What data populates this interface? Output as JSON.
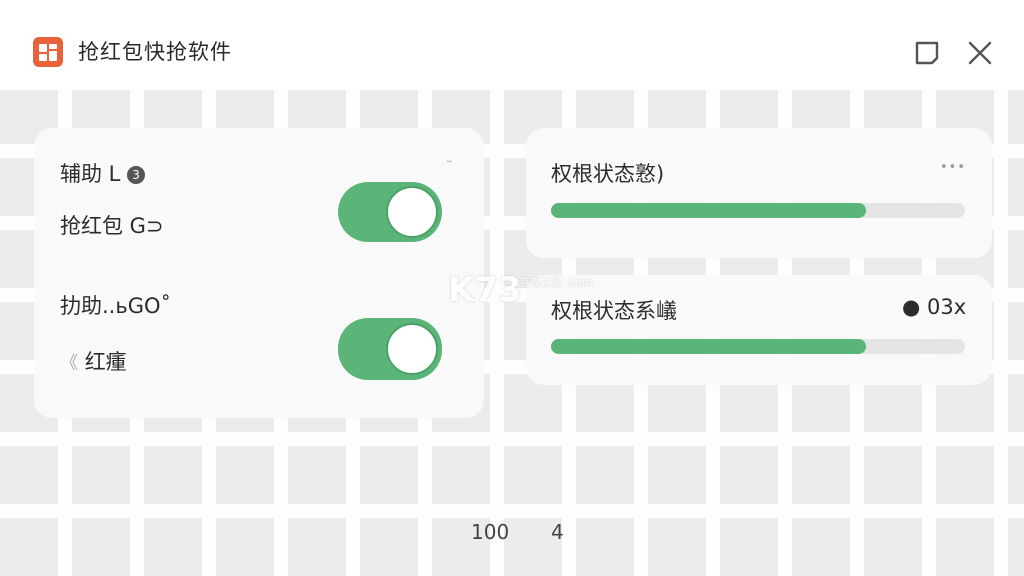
{
  "window": {
    "title": "抢红包快抢软件"
  },
  "left_panel": {
    "row1_label": "辅助 ᒪ",
    "row1_suffix": "3",
    "row2_label": "抢红包 G⊃",
    "row3_label": "扐助..ьGO˚",
    "row4_label": "红瘇",
    "row4_prefix": "《",
    "toggle1_on": true,
    "toggle2_on": true,
    "dots": "¨"
  },
  "right_panel": {
    "status1_label": "权根状态憝)",
    "status1_dots": "•••",
    "status1_progress": 0.76,
    "status2_label": "权根状态系嶬",
    "status2_value": "● 03x",
    "status2_progress": 0.76
  },
  "watermark": {
    "main": "K73",
    "sub": "游戏之家 .com"
  },
  "footer": {
    "left_num": "100",
    "right_num": "4"
  },
  "colors": {
    "accent": "#5bb478",
    "app_icon": "#e8633c"
  }
}
